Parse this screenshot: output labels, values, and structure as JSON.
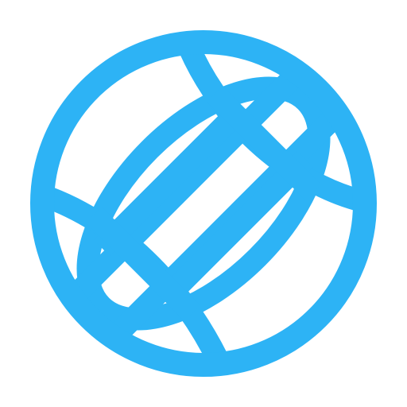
{
  "icon": {
    "name": "globe-icon",
    "color": "#2DB3F5",
    "background": "#FFFFFF"
  }
}
